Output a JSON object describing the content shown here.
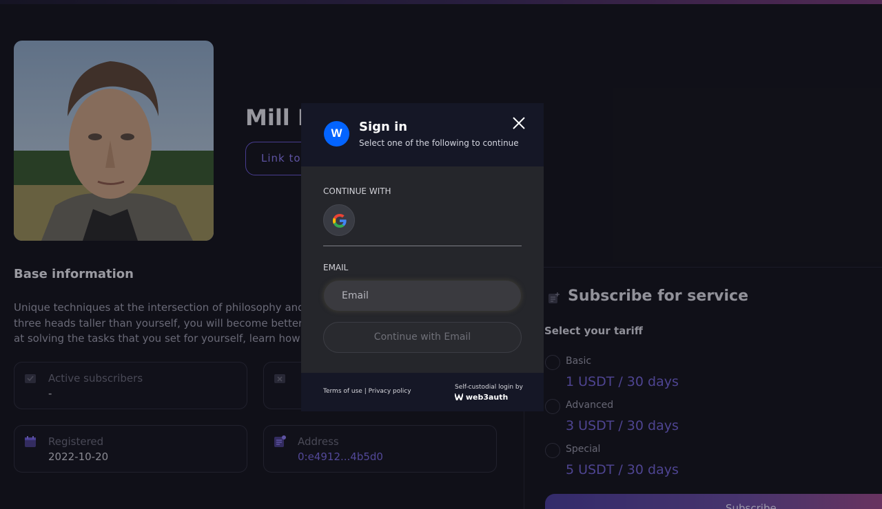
{
  "profile": {
    "name": "Mill Il",
    "link_button": "Link to"
  },
  "base_info": {
    "title": "Base information",
    "description": "Unique techniques at the intersection of philosophy and\nthree heads taller than yourself, you will become better\nat solving the tasks that you set for yourself, learn how t"
  },
  "stats": [
    {
      "label": "Active subscribers",
      "value": "-"
    },
    {
      "label": "",
      "value": ""
    },
    {
      "label": "Registered",
      "value": "2022-10-20"
    },
    {
      "label": "Address",
      "value": "0:e4912...4b5d0"
    }
  ],
  "subscribe": {
    "title": "Subscribe for service",
    "select_label": "Select your tariff",
    "tariffs": [
      {
        "name": "Basic",
        "price": "1 USDT / 30 days"
      },
      {
        "name": "Advanced",
        "price": "3 USDT / 30 days"
      },
      {
        "name": "Special",
        "price": "5 USDT / 30 days"
      }
    ],
    "button_label": "Subscribe"
  },
  "modal": {
    "logo_letter": "W",
    "title": "Sign in",
    "subtitle": "Select one of the following to continue",
    "continue_with_label": "CONTINUE WITH",
    "email_label": "EMAIL",
    "email_placeholder": "Email",
    "email_button": "Continue with Email",
    "terms": "Terms of use",
    "privacy": "Privacy policy",
    "self_custodial": "Self-custodial login by",
    "brand": "web3auth"
  },
  "colors": {
    "accent": "#7465d6",
    "modal_logo": "#0364ff",
    "background": "#14141d"
  }
}
